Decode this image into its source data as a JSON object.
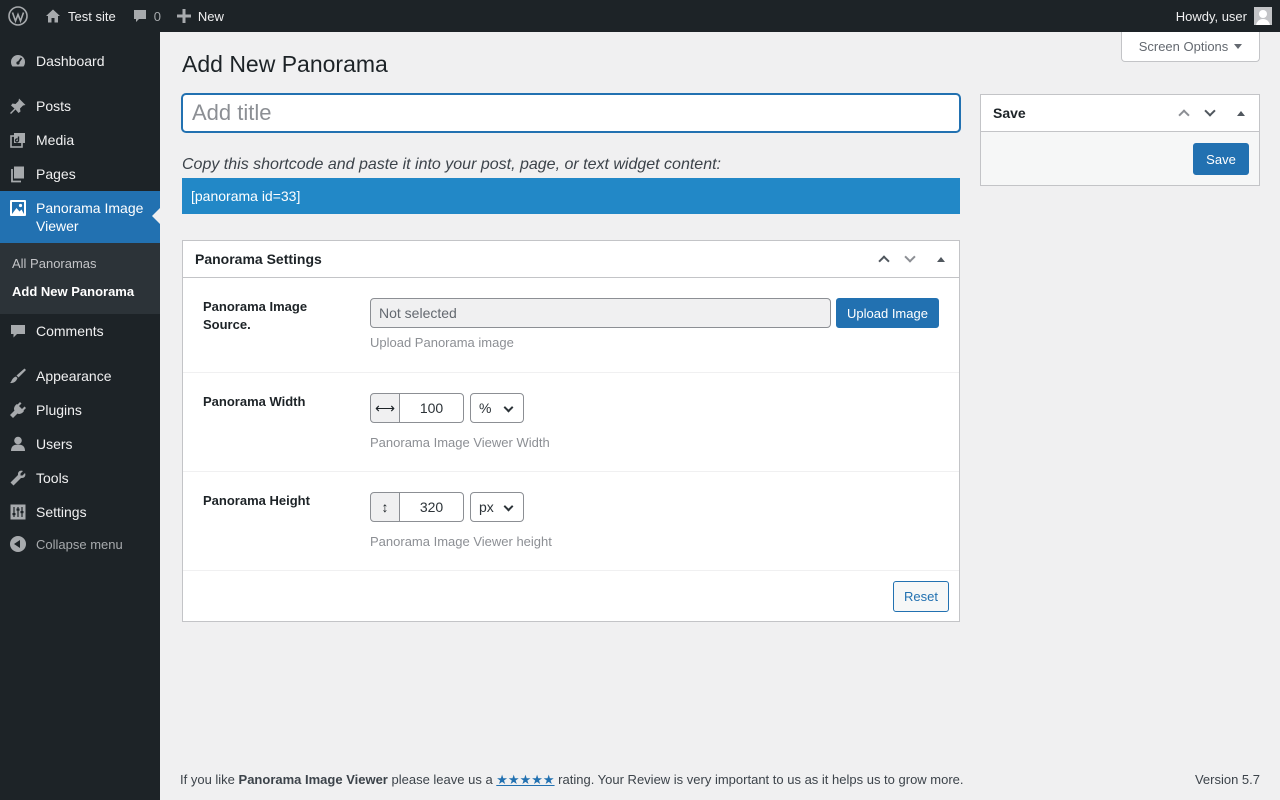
{
  "admin_bar": {
    "site_name": "Test site",
    "comments_count": "0",
    "new_label": "New",
    "howdy": "Howdy, user"
  },
  "sidebar": {
    "items": [
      {
        "label": "Dashboard",
        "icon": "dashboard-icon"
      },
      {
        "label": "Posts",
        "icon": "pin-icon"
      },
      {
        "label": "Media",
        "icon": "media-icon"
      },
      {
        "label": "Pages",
        "icon": "pages-icon"
      },
      {
        "label": "Panorama Image Viewer",
        "icon": "panorama-icon"
      },
      {
        "label": "Comments",
        "icon": "comment-icon"
      },
      {
        "label": "Appearance",
        "icon": "brush-icon"
      },
      {
        "label": "Plugins",
        "icon": "plugin-icon"
      },
      {
        "label": "Users",
        "icon": "user-icon"
      },
      {
        "label": "Tools",
        "icon": "wrench-icon"
      },
      {
        "label": "Settings",
        "icon": "settings-icon"
      }
    ],
    "submenu": [
      "All Panoramas",
      "Add New Panorama"
    ],
    "collapse_label": "Collapse menu"
  },
  "screen_options": "Screen Options",
  "page_title": "Add New Panorama",
  "title_placeholder": "Add title",
  "shortcode_help": "Copy this shortcode and paste it into your post, page, or text widget content:",
  "shortcode": "[panorama id=33]",
  "save_box": {
    "title": "Save",
    "button": "Save"
  },
  "settings": {
    "title": "Panorama Settings",
    "source_label": "Panorama Image Source.",
    "source_placeholder": "Not selected",
    "upload_button": "Upload Image",
    "source_desc": "Upload Panorama image",
    "width_label": "Panorama Width",
    "width_value": "100",
    "width_unit": "%",
    "width_desc": "Panorama Image Viewer Width",
    "height_label": "Panorama Height",
    "height_value": "320",
    "height_unit": "px",
    "height_desc": "Panorama Image Viewer height",
    "reset_button": "Reset"
  },
  "footer": {
    "text_before": "If you like ",
    "plugin_name": "Panorama Image Viewer",
    "text_middle": " please leave us a ",
    "stars": "★★★★★",
    "text_after": " rating. Your Review is very important to us as it helps us to grow more.",
    "version": "Version 5.7"
  },
  "colors": {
    "admin_bar": "#1d2327",
    "accent": "#2271b1",
    "shortcode_bg": "#2288c7",
    "background": "#f0f0f1"
  }
}
